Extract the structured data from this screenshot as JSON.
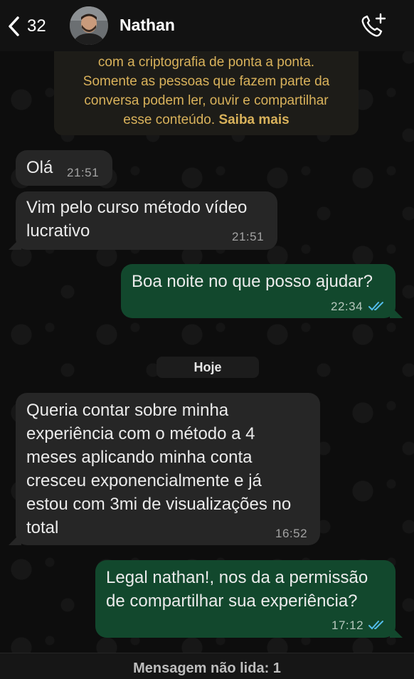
{
  "header": {
    "back_count": "32",
    "contact_name": "Nathan"
  },
  "notice": {
    "line1": "com a criptografia de ponta a ponta.",
    "line2": "Somente as pessoas que fazem parte da",
    "line3": "conversa podem ler, ouvir e compartilhar",
    "line4_prefix": "esse conteúdo. ",
    "line4_link": "Saiba mais"
  },
  "messages": [
    {
      "direction": "in",
      "lines": [
        "Olá"
      ],
      "time": "21:51"
    },
    {
      "direction": "in",
      "lines": [
        "Vim pelo curso método vídeo",
        "lucrativo"
      ],
      "time": "21:51"
    },
    {
      "direction": "out",
      "lines": [
        "Boa noite no que posso ajudar?"
      ],
      "time": "22:34",
      "status": "read"
    },
    {
      "direction": "in",
      "lines": [
        "Queria contar sobre minha",
        "experiência com o método a 4",
        "meses aplicando minha conta",
        "cresceu exponencialmente e já",
        "estou com 3mi de visualizações no",
        "total"
      ],
      "time": "16:52"
    },
    {
      "direction": "out",
      "lines": [
        "Legal nathan!, nos da a permissão",
        "de compartilhar sua experiência?"
      ],
      "time": "17:12",
      "status": "read"
    }
  ],
  "date_separator": "Hoje",
  "unread_banner": "Mensagem não lida: 1",
  "colors": {
    "incoming_bubble": "#262626",
    "outgoing_bubble": "#12482d",
    "notice_text": "#d9b25b",
    "read_ticks": "#53bdeb"
  }
}
